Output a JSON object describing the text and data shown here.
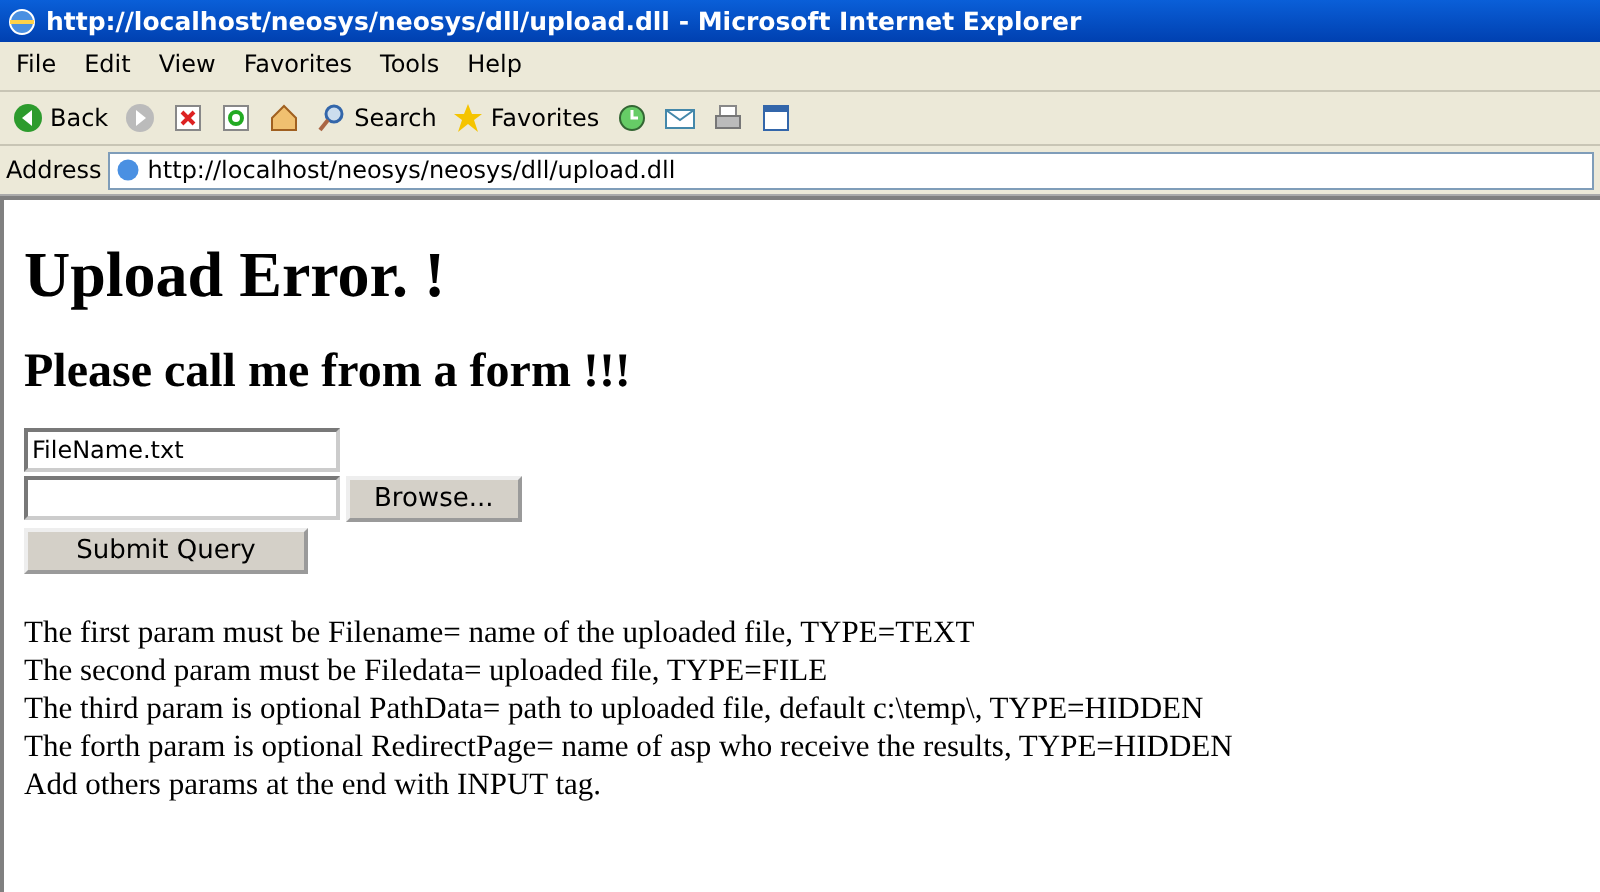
{
  "window": {
    "title": "http://localhost/neosys/neosys/dll/upload.dll - Microsoft Internet Explorer"
  },
  "menu": [
    "File",
    "Edit",
    "View",
    "Favorites",
    "Tools",
    "Help"
  ],
  "toolbar": [
    {
      "kind": "back",
      "label": "Back"
    },
    {
      "kind": "forward"
    },
    {
      "kind": "stop"
    },
    {
      "kind": "refresh"
    },
    {
      "kind": "home"
    },
    {
      "kind": "search",
      "label": "Search"
    },
    {
      "kind": "favorites",
      "label": "Favorites"
    },
    {
      "kind": "history"
    },
    {
      "kind": "mail"
    },
    {
      "kind": "print"
    },
    {
      "kind": "edit"
    }
  ],
  "address": {
    "label": "Address",
    "value": "http://localhost/neosys/neosys/dll/upload.dll"
  },
  "page": {
    "heading": "Upload Error. !",
    "subheading": "Please call me from a form !!!",
    "filename_field": {
      "value": "FileName.txt"
    },
    "browse_button": "Browse...",
    "submit_button": "Submit Query",
    "lines": [
      "The first param must be Filename= name of the uploaded file, TYPE=TEXT",
      "The second param must be Filedata= uploaded file, TYPE=FILE",
      "The third param is optional PathData= path to uploaded file, default c:\\temp\\, TYPE=HIDDEN",
      "The forth param is optional RedirectPage= name of asp who receive the results, TYPE=HIDDEN",
      "Add others params at the end with INPUT tag."
    ]
  }
}
